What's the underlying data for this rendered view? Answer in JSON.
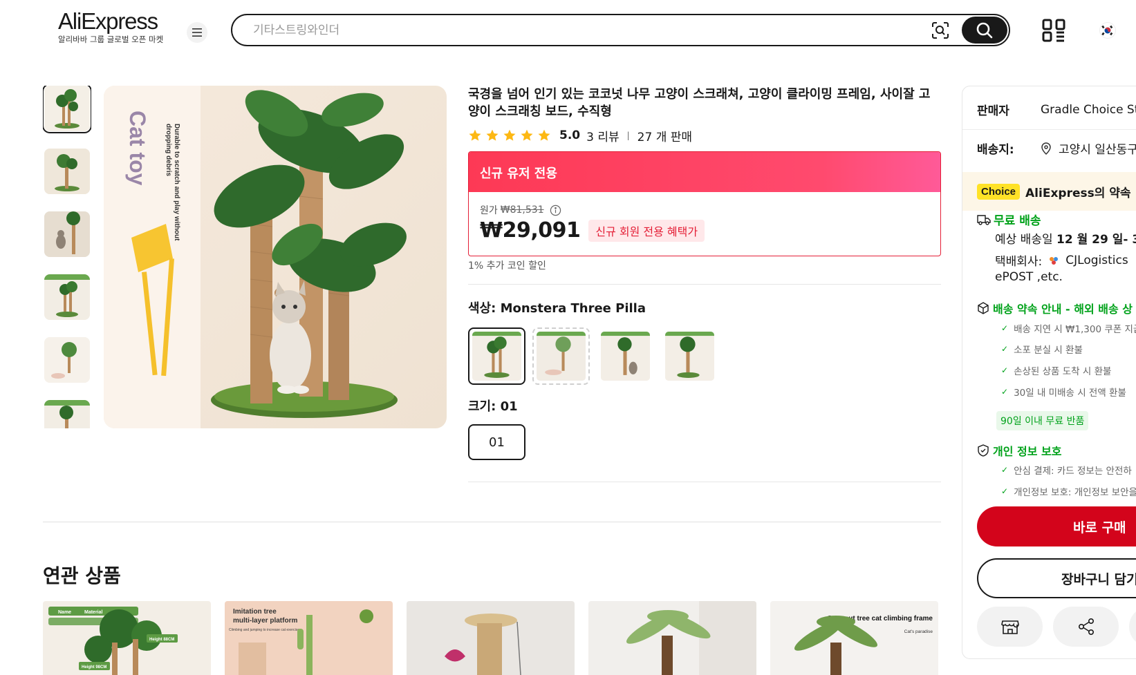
{
  "header": {
    "logo_text": "AliExpress",
    "logo_tagline": "알리바바 그룹 글로벌 오픈 마켓",
    "search_placeholder": "기타스트링와인더"
  },
  "product": {
    "title": "국경을 넘어 인기 있는 코코넛 나무 고양이 스크래쳐, 고양이 클라이밍 프레임, 사이잘 고양이 스크래칭 보드, 수직형",
    "rating": "5.0",
    "star_count": 5,
    "reviews": "3 리뷰",
    "sold": "27 개 판매",
    "main_image_text_1": "Cat toy",
    "main_image_text_2": "Durable to scratch and play without",
    "main_image_text_3": "dropping debris"
  },
  "promo": {
    "header": "신규 유저 전용",
    "original_label": "원가",
    "original_price": "₩81,531",
    "price": "₩29,091",
    "badge": "신규 회원 전용 혜택가",
    "coin_note": "1% 추가 코인 할인"
  },
  "options": {
    "color_label": "색상: Monstera Three Pilla",
    "size_label": "크기: 01",
    "size_value": "01"
  },
  "related": {
    "title": "연관 상품",
    "card1_tag_a": "Name",
    "card1_tag_b": "Material",
    "card1_tag_c": "Height 88CM",
    "card1_tag_d": "Height 98CM",
    "card2_line1": "Imitation tree",
    "card2_line2": "multi-layer platform",
    "card2_line3": "Climbing and jumping to increase cat exercise",
    "card5_line1": "Coconut tree cat climbing frame",
    "card5_line2": "Cat's paradise"
  },
  "panel": {
    "seller_label": "판매자",
    "seller_value": "Gradle Choice St",
    "ship_label": "배송지:",
    "ship_value": "고양시 일산동구",
    "choice_badge": "Choice",
    "choice_text": "AliExpress의 약속",
    "free_shipping": "무료 배송",
    "delivery_label": "예상 배송일",
    "delivery_value": "12 월 29 일- 3",
    "courier_label": "택배회사:",
    "courier_value": "CJLogistics",
    "courier_more": "ePOST ,etc.",
    "promise_title": "배송 약속 안내 - 해외 배송 상",
    "promise_items": [
      "배송 지연 시 ₩1,300 쿠폰 지급",
      "소포 분실 시 환불",
      "손상된 상품 도착 시 환불",
      "30일 내 미배송 시 전액 환불"
    ],
    "return_badge": "90일 이내 무료 반품",
    "privacy_title": "개인 정보 보호",
    "privacy_items": [
      "안심 결제: 카드 정보는 안전하",
      "개인정보 보호: 개인정보 보안을"
    ],
    "buy_now": "바로 구매",
    "add_cart": "장바구니 담기"
  },
  "colors": {
    "accent_red": "#e41e36",
    "buy_red": "#d3041b",
    "promo_gradient_start": "#fd3955",
    "star_yellow": "#fdb813",
    "green": "#00a21a",
    "choice_yellow": "#ffe227"
  },
  "icons": [
    "menu-icon",
    "camera-search-icon",
    "search-icon",
    "qr-code-icon",
    "korea-flag-icon",
    "star-icon",
    "info-icon",
    "location-pin-icon",
    "truck-icon",
    "box-icon",
    "shield-icon",
    "check-icon",
    "store-icon",
    "share-icon"
  ]
}
